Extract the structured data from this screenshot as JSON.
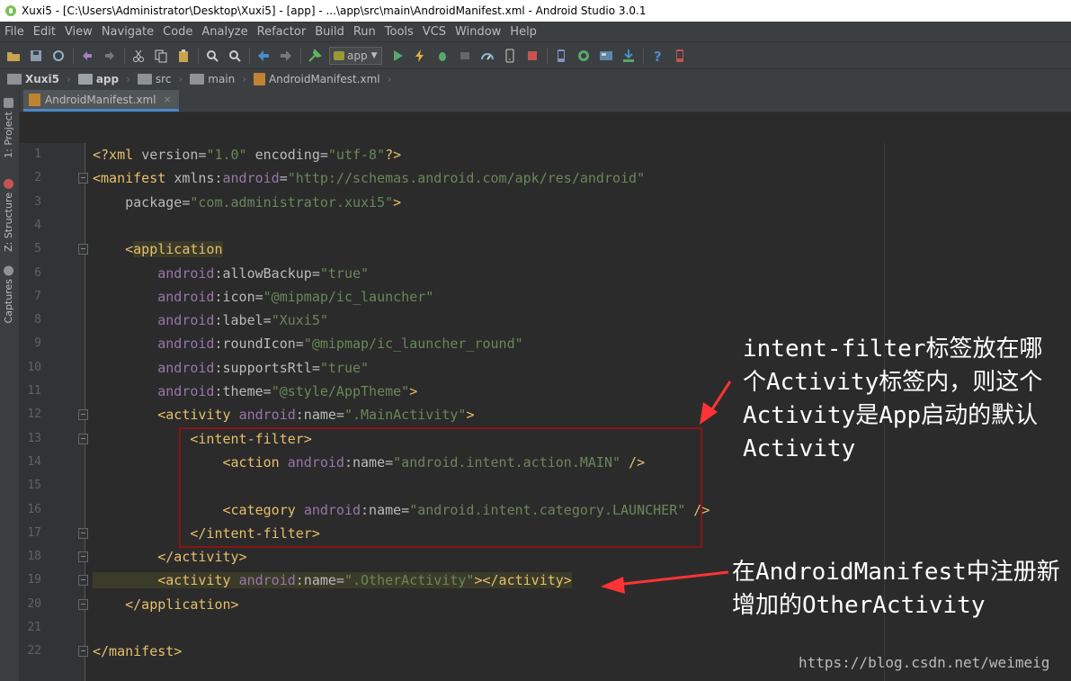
{
  "window": {
    "title": "Xuxi5 - [C:\\Users\\Administrator\\Desktop\\Xuxi5] - [app] - ...\\app\\src\\main\\AndroidManifest.xml - Android Studio 3.0.1"
  },
  "menu": [
    "File",
    "Edit",
    "View",
    "Navigate",
    "Code",
    "Analyze",
    "Refactor",
    "Build",
    "Run",
    "Tools",
    "VCS",
    "Window",
    "Help"
  ],
  "toolbar": {
    "run_config": "app",
    "icons": [
      "open-icon",
      "save-icon",
      "sync-icon",
      "undo-icon",
      "redo-icon",
      "cut-icon",
      "copy-icon",
      "paste-icon",
      "find-icon",
      "replace-icon",
      "back-icon",
      "forward-icon",
      "build-icon",
      "run-icon",
      "apply-changes-icon",
      "debug-icon",
      "attach-icon",
      "profile-icon",
      "device-icon",
      "stop-icon",
      "avd-icon",
      "gradle-sync-icon",
      "project-structure-icon",
      "sdk-manager-icon",
      "help-icon",
      "device-monitor-icon"
    ]
  },
  "breadcrumb": [
    "Xuxi5",
    "app",
    "src",
    "main",
    "AndroidManifest.xml"
  ],
  "left_tabs": [
    "1: Project",
    "Z: Structure",
    "Captures"
  ],
  "editor_tab": {
    "label": "AndroidManifest.xml"
  },
  "code_lines": [
    {
      "n": "1",
      "parts": [
        [
          "p",
          "<?xml "
        ],
        [
          "a",
          "version="
        ],
        [
          "v",
          "\"1.0\""
        ],
        [
          "a",
          " encoding="
        ],
        [
          "v",
          "\"utf-8\""
        ],
        [
          "p",
          "?>"
        ]
      ]
    },
    {
      "n": "2",
      "parts": [
        [
          "t",
          "<manifest "
        ],
        [
          "a",
          "xmlns:"
        ],
        [
          "ns",
          "android"
        ],
        [
          "a",
          "="
        ],
        [
          "v",
          "\"http://schemas.android.com/apk/res/android\""
        ]
      ]
    },
    {
      "n": "3",
      "parts": [
        [
          "a",
          "    package="
        ],
        [
          "v",
          "\"com.administrator.xuxi5\""
        ],
        [
          "t",
          ">"
        ]
      ]
    },
    {
      "n": "4",
      "parts": []
    },
    {
      "n": "5",
      "parts": [
        [
          "t",
          "    <"
        ],
        [
          "hl",
          "application"
        ]
      ]
    },
    {
      "n": "6",
      "parts": [
        [
          "ns",
          "        android"
        ],
        [
          "a",
          ":allowBackup="
        ],
        [
          "v",
          "\"true\""
        ]
      ]
    },
    {
      "n": "7",
      "parts": [
        [
          "ns",
          "        android"
        ],
        [
          "a",
          ":icon="
        ],
        [
          "v",
          "\"@mipmap/ic_launcher\""
        ]
      ]
    },
    {
      "n": "8",
      "parts": [
        [
          "ns",
          "        android"
        ],
        [
          "a",
          ":label="
        ],
        [
          "v",
          "\"Xuxi5\""
        ]
      ]
    },
    {
      "n": "9",
      "parts": [
        [
          "ns",
          "        android"
        ],
        [
          "a",
          ":roundIcon="
        ],
        [
          "v",
          "\"@mipmap/ic_launcher_round\""
        ]
      ]
    },
    {
      "n": "10",
      "parts": [
        [
          "ns",
          "        android"
        ],
        [
          "a",
          ":supportsRtl="
        ],
        [
          "v",
          "\"true\""
        ]
      ]
    },
    {
      "n": "11",
      "parts": [
        [
          "ns",
          "        android"
        ],
        [
          "a",
          ":theme="
        ],
        [
          "v",
          "\"@style/AppTheme\""
        ],
        [
          "t",
          ">"
        ]
      ]
    },
    {
      "n": "12",
      "parts": [
        [
          "t",
          "        <activity "
        ],
        [
          "ns",
          "android"
        ],
        [
          "a",
          ":name="
        ],
        [
          "v",
          "\".MainActivity\""
        ],
        [
          "t",
          ">"
        ]
      ]
    },
    {
      "n": "13",
      "parts": [
        [
          "t",
          "            <intent-filter>"
        ]
      ]
    },
    {
      "n": "14",
      "parts": [
        [
          "t",
          "                <action "
        ],
        [
          "ns",
          "android"
        ],
        [
          "a",
          ":name="
        ],
        [
          "v",
          "\"android.intent.action.MAIN\""
        ],
        [
          "t",
          " />"
        ]
      ]
    },
    {
      "n": "15",
      "parts": []
    },
    {
      "n": "16",
      "parts": [
        [
          "t",
          "                <category "
        ],
        [
          "ns",
          "android"
        ],
        [
          "a",
          ":name="
        ],
        [
          "v",
          "\"android.intent.category.LAUNCHER\""
        ],
        [
          "t",
          " />"
        ]
      ]
    },
    {
      "n": "17",
      "parts": [
        [
          "t",
          "            </intent-filter>"
        ]
      ]
    },
    {
      "n": "18",
      "parts": [
        [
          "t",
          "        </activity>"
        ]
      ]
    },
    {
      "n": "19",
      "parts": [
        [
          "t",
          "        <activity "
        ],
        [
          "ns",
          "android"
        ],
        [
          "a",
          ":name="
        ],
        [
          "v",
          "\".OtherActivity\""
        ],
        [
          "t",
          "></activity>"
        ]
      ]
    },
    {
      "n": "20",
      "parts": [
        [
          "t",
          "    </application>"
        ]
      ]
    },
    {
      "n": "21",
      "parts": []
    },
    {
      "n": "22",
      "parts": [
        [
          "t",
          "</manifest>"
        ]
      ]
    }
  ],
  "annotations": {
    "first": "intent-filter标签放在哪\n个Activity标签内，则这个\nActivity是App启动的默认\nActivity",
    "second": "在AndroidManifest中注册新\n增加的OtherActivity"
  },
  "watermark": "https://blog.csdn.net/weimeig"
}
